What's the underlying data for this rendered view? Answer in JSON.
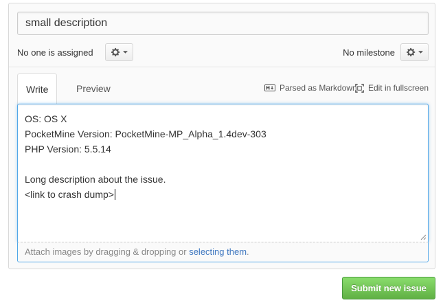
{
  "issue": {
    "title_value": "small description"
  },
  "meta": {
    "assignee_text": "No one is assigned",
    "milestone_text": "No milestone"
  },
  "tabs": {
    "write_label": "Write",
    "preview_label": "Preview"
  },
  "toolbar": {
    "markdown_label": "Parsed as Markdown",
    "fullscreen_label": "Edit in fullscreen"
  },
  "body": {
    "lines": [
      "OS: OS X",
      "PocketMine Version: PocketMine-MP_Alpha_1.4dev-303",
      "PHP Version: 5.5.14",
      "",
      "Long description about the issue.",
      "<link to crash dump>"
    ]
  },
  "dropzone": {
    "text": "Attach images by dragging & dropping or ",
    "link_text": "selecting them",
    "suffix": "."
  },
  "actions": {
    "submit_label": "Submit new issue"
  },
  "colors": {
    "submit_green": "#60b044",
    "focus_blue": "#51a7e8",
    "link_blue": "#4078c0"
  }
}
